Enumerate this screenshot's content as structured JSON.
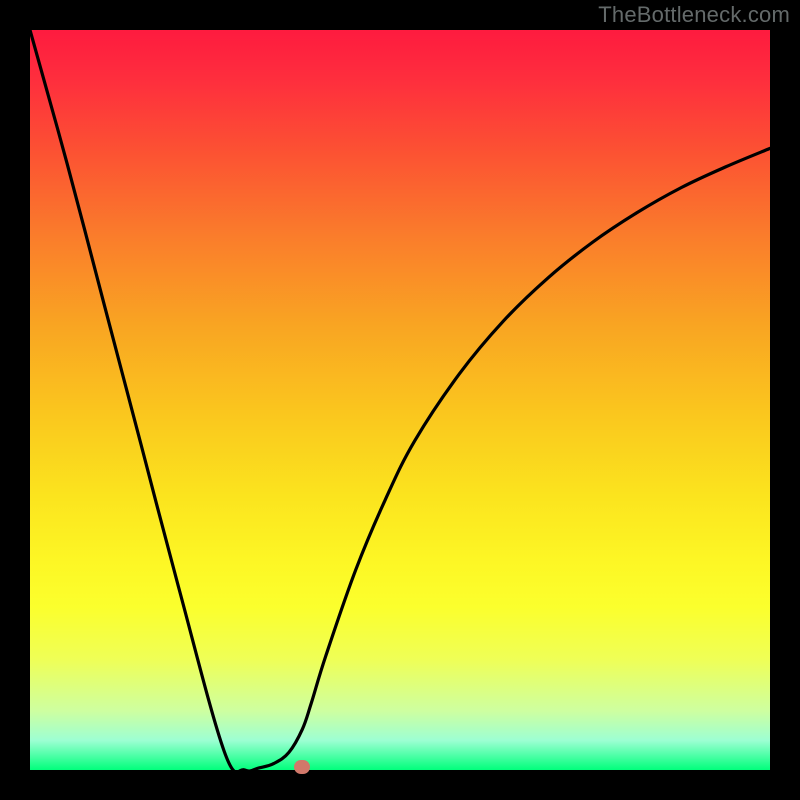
{
  "watermark": {
    "text": "TheBottleneck.com"
  },
  "chart_data": {
    "type": "line",
    "title": "",
    "xlabel": "",
    "ylabel": "",
    "x": [
      0.0,
      0.05,
      0.1,
      0.15,
      0.2,
      0.2625,
      0.29,
      0.31,
      0.33,
      0.35,
      0.368,
      0.38,
      0.4,
      0.44,
      0.48,
      0.52,
      0.58,
      0.64,
      0.7,
      0.76,
      0.82,
      0.88,
      0.94,
      1.0
    ],
    "y": [
      1.0,
      0.82,
      0.63,
      0.44,
      0.25,
      0.025,
      0.0,
      0.003,
      0.009,
      0.024,
      0.055,
      0.09,
      0.155,
      0.27,
      0.365,
      0.445,
      0.535,
      0.607,
      0.665,
      0.713,
      0.753,
      0.787,
      0.815,
      0.84
    ],
    "xlim": [
      0,
      1
    ],
    "ylim": [
      0,
      1
    ],
    "marker": {
      "x": 0.368,
      "y": 0.0
    },
    "background": "heat-gradient",
    "axes_visible": false,
    "legend": null
  },
  "plot": {
    "px": 740
  }
}
